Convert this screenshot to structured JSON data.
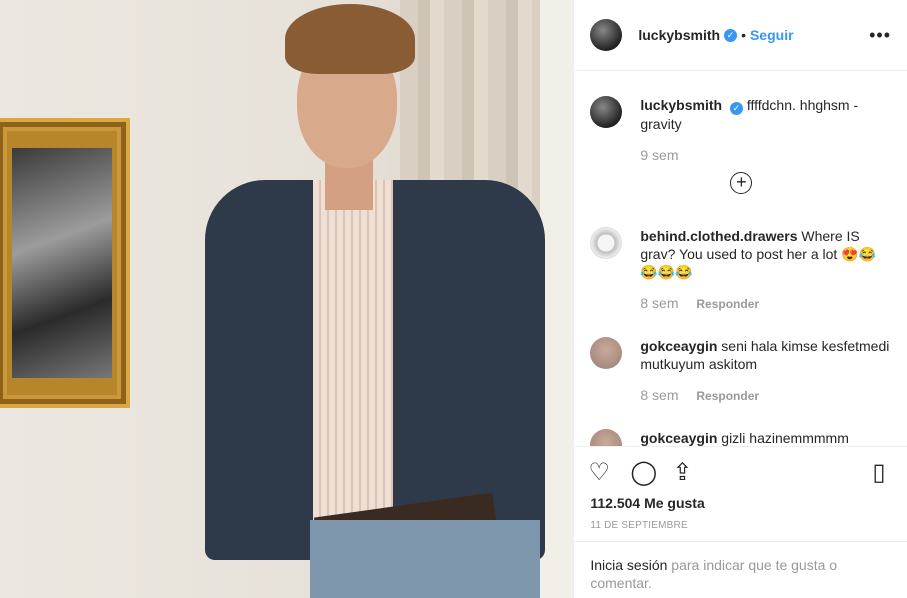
{
  "header": {
    "username": "luckybsmith",
    "verified_icon": "verified-badge-icon",
    "separator": "•",
    "follow_label": "Seguir",
    "more_icon": "more-options-icon",
    "more_glyph": "•••"
  },
  "caption": {
    "username": "luckybsmith",
    "text": "ffffdchn. hhghsm - gravity",
    "time": "9 sem"
  },
  "load_more_icon": "add-circle-icon",
  "comments": [
    {
      "username": "behind.clothed.drawers",
      "text": "Where IS grav? You used to post her a lot 😍😂😂😂😂",
      "time": "8 sem",
      "reply_label": "Responder"
    },
    {
      "username": "gokceaygin",
      "text": "seni hala kimse kesfetmedi mutkuyum askitom",
      "time": "8 sem",
      "reply_label": "Responder"
    },
    {
      "username": "gokceaygin",
      "text": "gizli hazinemmmmm"
    }
  ],
  "actions": {
    "like_icon": "heart-icon",
    "comment_icon": "comment-icon",
    "share_icon": "share-icon",
    "save_icon": "bookmark-icon",
    "likes": "112.504 Me gusta",
    "date": "11 DE SEPTIEMBRE"
  },
  "login_prompt": {
    "link": "Inicia sesión",
    "text": " para indicar que te gusta o comentar."
  },
  "colors": {
    "accent": "#3897f0",
    "text": "#262626",
    "muted": "#999999"
  }
}
